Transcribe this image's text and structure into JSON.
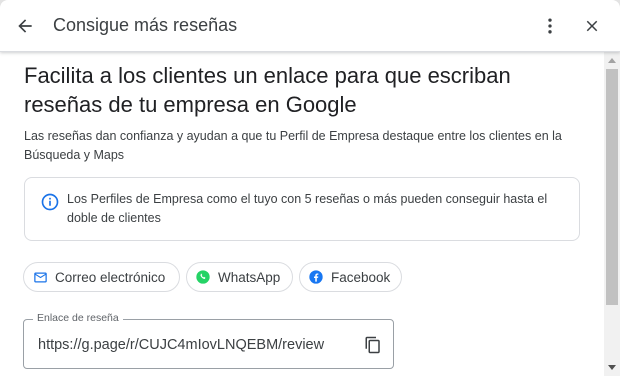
{
  "header": {
    "title": "Consigue más reseñas"
  },
  "main": {
    "headline": "Facilita a los clientes un enlace para que escriban reseñas de tu empresa en Google",
    "description": "Las reseñas dan confianza y ayudan a que tu Perfil de Empresa destaque entre los clientes en la Búsqueda y Maps",
    "info_text": "Los Perfiles de Empresa como el tuyo con 5 reseñas o más pueden conseguir hasta el doble de clientes",
    "share_options": [
      {
        "label": "Correo electrónico",
        "icon": "mail-icon",
        "color": "#1a73e8"
      },
      {
        "label": "WhatsApp",
        "icon": "whatsapp-icon",
        "color": "#25d366"
      },
      {
        "label": "Facebook",
        "icon": "facebook-icon",
        "color": "#1877f2"
      }
    ],
    "review_link": {
      "label": "Enlace de reseña",
      "value": "https://g.page/r/CUJC4mIovLNQEBM/review"
    }
  },
  "colors": {
    "accent": "#1a73e8",
    "text_primary": "#202124",
    "text_secondary": "#3c4043",
    "border": "#dadce0"
  }
}
